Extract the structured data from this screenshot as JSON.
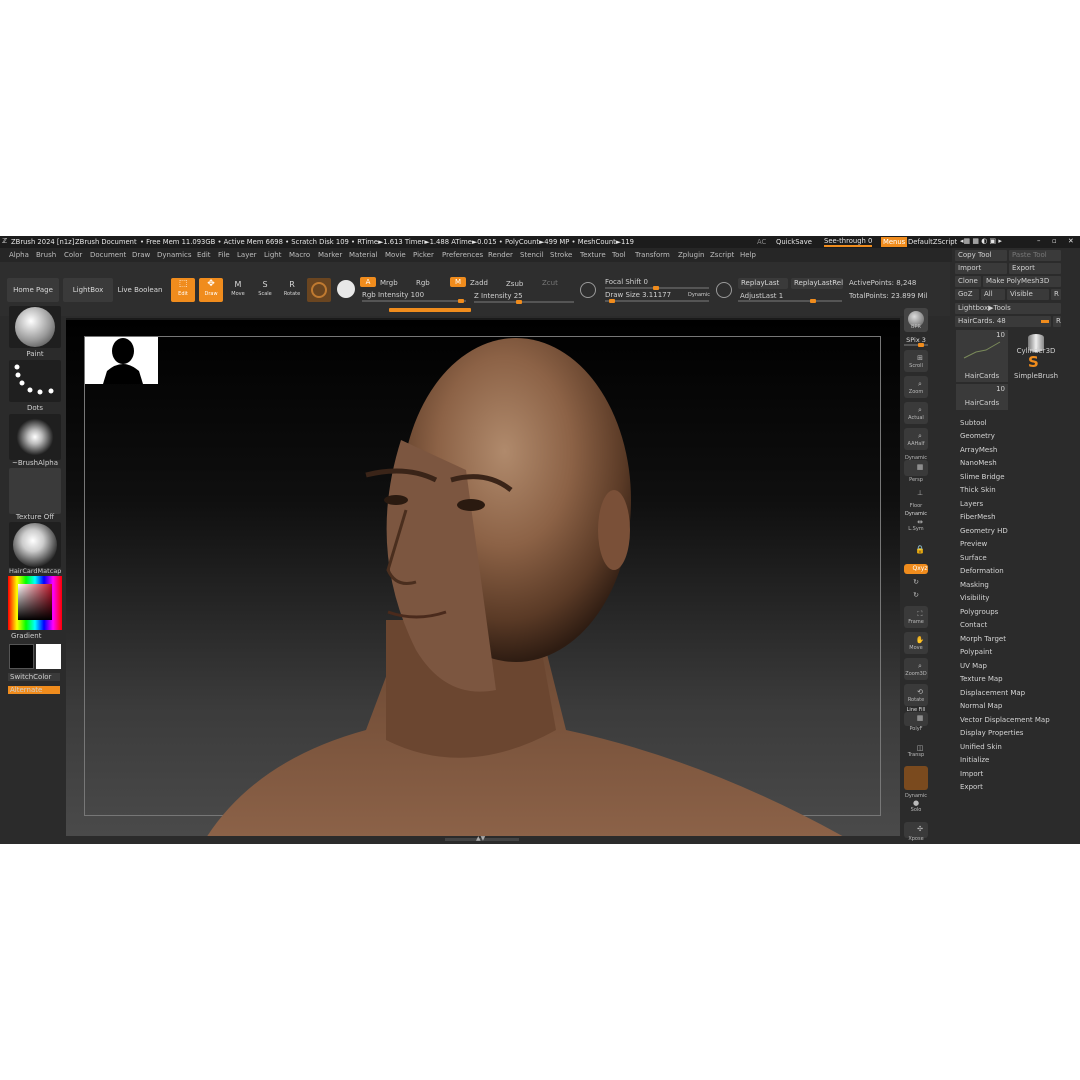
{
  "titlebar": {
    "app": "ZBrush 2024 [n1z]",
    "doc": "ZBrush Document",
    "stats": "• Free Mem 11.093GB • Active Mem 6698 • Scratch Disk 109 • RTime►1.613 Timer►1.488 ATime►0.015 • PolyCount►499 MP • MeshCount►119",
    "ac": "AC",
    "quicksave": "QuickSave",
    "seethrough": "See-through  0",
    "menus": "Menus",
    "script": "DefaultZScript"
  },
  "menus": [
    "Alpha",
    "Brush",
    "Color",
    "Document",
    "Draw",
    "Dynamics",
    "Edit",
    "File",
    "Layer",
    "Light",
    "Macro",
    "Marker",
    "Material",
    "Movie",
    "Picker",
    "Preferences",
    "Render",
    "Stencil",
    "Stroke",
    "Texture",
    "Tool",
    "Transform",
    "Zplugin",
    "Zscript",
    "Help"
  ],
  "toolbar": {
    "home": "Home Page",
    "lightbox": "LightBox",
    "liveboolean": "Live Boolean",
    "edit": "Edit",
    "draw": "Draw",
    "move": "Move",
    "scale": "Scale",
    "rotate": "Rotate",
    "a": "A",
    "mrgb": "Mrgb",
    "rgb": "Rgb",
    "m": "M",
    "zadd": "Zadd",
    "zsub": "Zsub",
    "zcut": "Zcut",
    "rgb_intensity": "Rgb Intensity 100",
    "z_intensity": "Z Intensity 25",
    "focal_shift": "Focal Shift 0",
    "draw_size": "Draw Size 3.11177",
    "dynamic": "Dynamic",
    "replaylast": "ReplayLast",
    "replaylastrel": "ReplayLastRel",
    "adjustlast": "AdjustLast 1",
    "activepoints": "ActivePoints: 8,248",
    "totalpoints": "TotalPoints: 23.899 Mil"
  },
  "left": {
    "paint": "Paint",
    "dots": "Dots",
    "brushalpha": "~BrushAlpha",
    "textureoff": "Texture Off",
    "matcap": "HairCardMatcap",
    "gradient": "Gradient",
    "switchcolor": "SwitchColor",
    "alternate": "Alternate"
  },
  "right": {
    "bpr": "BPR",
    "spix": "SPix 3",
    "scroll": "Scroll",
    "zoom": "Zoom",
    "actual": "Actual",
    "aahalf": "AAHalf",
    "dynamic": "Dynamic",
    "persp": "Persp",
    "floor": "Floor",
    "dynamic2": "Dynamic",
    "lsym": "L.Sym",
    "xyz": "Qxyz",
    "frame": "Frame",
    "move": "Move",
    "zoom3d": "Zoom3D",
    "rotate": "Rotate",
    "linefill": "Line Fill",
    "polyf": "PolyF",
    "transp": "Transp",
    "solo": "Solo",
    "dynamic3": "Dynamic",
    "xpose": "Xpose"
  },
  "tray": {
    "copytool": "Copy Tool",
    "pastetool": "Paste Tool",
    "import": "Import",
    "export": "Export",
    "clone": "Clone",
    "makepolymesh": "Make PolyMesh3D",
    "goz": "GoZ",
    "all": "All",
    "visible": "Visible",
    "r": "R",
    "lightboxtools": "Lightbox▶Tools",
    "haircards": "HairCards. 48",
    "r2": "R",
    "count1": "10",
    "count2": "10",
    "t1": "HairCards",
    "t2": "Cylinder3D",
    "t3": "SimpleBrush",
    "t4": "HairCards",
    "items": [
      "Subtool",
      "Geometry",
      "ArrayMesh",
      "NanoMesh",
      "Slime Bridge",
      "Thick Skin",
      "Layers",
      "FiberMesh",
      "Geometry HD",
      "Preview",
      "Surface",
      "Deformation",
      "Masking",
      "Visibility",
      "Polygroups",
      "Contact",
      "Morph Target",
      "Polypaint",
      "UV Map",
      "Texture Map",
      "Displacement Map",
      "Normal Map",
      "Vector Displacement Map",
      "Display Properties",
      "Unified Skin",
      "Initialize",
      "Import",
      "Export"
    ]
  }
}
